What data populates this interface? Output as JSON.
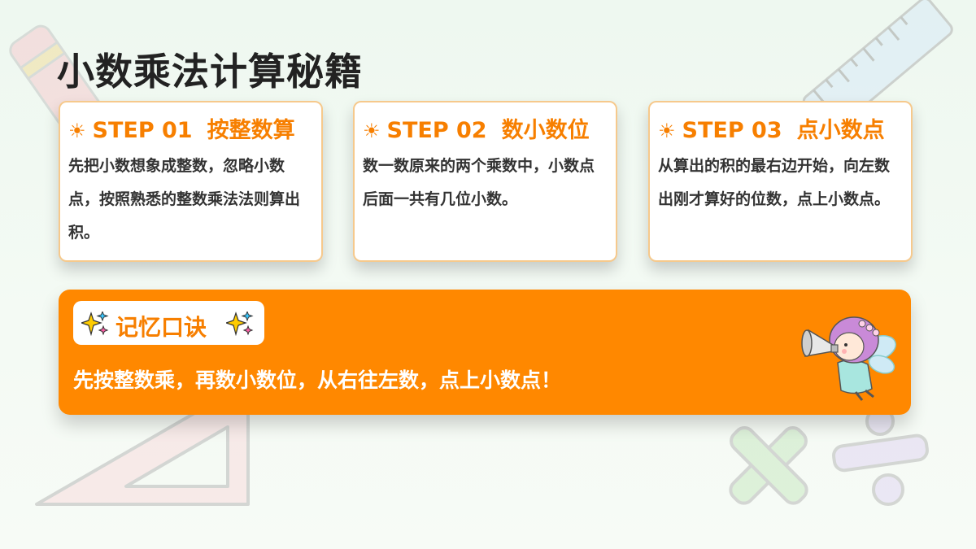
{
  "title": "小数乘法计算秘籍",
  "steps": [
    {
      "icon": "sun-icon",
      "sun": "☀",
      "step": "STEP 01",
      "name": "按整数算",
      "body": "先把小数想象成整数，忽略小数点，按照熟悉的整数乘法法则算出积。"
    },
    {
      "icon": "sun-icon",
      "sun": "☀",
      "step": "STEP 02",
      "name": "数小数位",
      "body": "数一数原来的两个乘数中，小数点后面一共有几位小数。"
    },
    {
      "icon": "sun-icon",
      "sun": "☀",
      "step": "STEP 03",
      "name": "点小数点",
      "body": "从算出的积的最右边开始，向左数出刚才算好的位数，点上小数点。"
    }
  ],
  "memo": {
    "label": "记忆口诀",
    "text": "先按整数乘，再数小数位，从右往左数，点上小数点！"
  },
  "colors": {
    "accent": "#ff8800",
    "accent_text": "#f77f00",
    "card_border": "#f6c98c",
    "title": "#222222"
  }
}
